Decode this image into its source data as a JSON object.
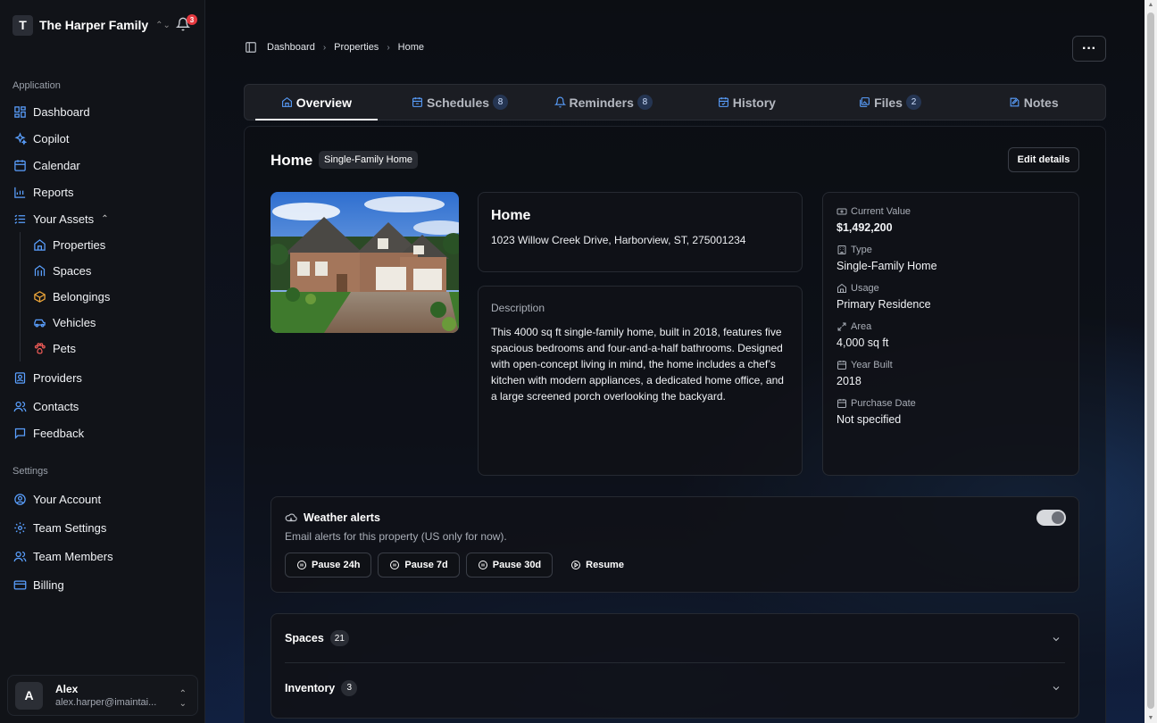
{
  "family": {
    "initial": "T",
    "name": "The Harper Family",
    "notifications": "3"
  },
  "sidebar": {
    "application_label": "Application",
    "items": [
      {
        "label": "Dashboard",
        "icon": "dashboard-icon"
      },
      {
        "label": "Copilot",
        "icon": "sparkle-icon"
      },
      {
        "label": "Calendar",
        "icon": "calendar-icon"
      },
      {
        "label": "Reports",
        "icon": "chart-icon"
      },
      {
        "label": "Your Assets",
        "icon": "list-icon"
      }
    ],
    "assets": [
      {
        "label": "Properties",
        "icon": "house-icon",
        "color": "#5aa0ff"
      },
      {
        "label": "Spaces",
        "icon": "columns-icon",
        "color": "#5aa0ff"
      },
      {
        "label": "Belongings",
        "icon": "box-icon",
        "color": "#f0a83a"
      },
      {
        "label": "Vehicles",
        "icon": "car-icon",
        "color": "#5aa0ff"
      },
      {
        "label": "Pets",
        "icon": "paw-icon",
        "color": "#ef5b57"
      }
    ],
    "more_items": [
      {
        "label": "Providers",
        "icon": "contact-book-icon"
      },
      {
        "label": "Contacts",
        "icon": "users-icon"
      },
      {
        "label": "Feedback",
        "icon": "message-icon"
      }
    ],
    "settings_label": "Settings",
    "settings_items": [
      {
        "label": "Your Account",
        "icon": "user-circle-icon"
      },
      {
        "label": "Team Settings",
        "icon": "gear-icon"
      },
      {
        "label": "Team Members",
        "icon": "users-icon"
      },
      {
        "label": "Billing",
        "icon": "card-icon"
      }
    ]
  },
  "user": {
    "initial": "A",
    "name": "Alex",
    "email": "alex.harper@imaintai..."
  },
  "breadcrumb": {
    "items": [
      "Dashboard",
      "Properties",
      "Home"
    ]
  },
  "tabs": [
    {
      "label": "Overview",
      "icon": "house-icon",
      "count": ""
    },
    {
      "label": "Schedules",
      "icon": "calendar-sync-icon",
      "count": "8"
    },
    {
      "label": "Reminders",
      "icon": "bell-icon",
      "count": "8"
    },
    {
      "label": "History",
      "icon": "calendar-check-icon",
      "count": ""
    },
    {
      "label": "Files",
      "icon": "images-icon",
      "count": "2"
    },
    {
      "label": "Notes",
      "icon": "note-icon",
      "count": ""
    }
  ],
  "property": {
    "title": "Home",
    "type_badge": "Single-Family Home",
    "edit_label": "Edit details",
    "card_title": "Home",
    "address": "1023 Willow Creek Drive, Harborview, ST, 275001234",
    "description_label": "Description",
    "description": "This 4000 sq ft single-family home, built in 2018, features five spacious bedrooms and four-and-a-half bathrooms. Designed with open-concept living in mind, the home includes a chef’s kitchen with modern appliances, a dedicated home office, and a large screened porch overlooking the backyard."
  },
  "facts": [
    {
      "label": "Current Value",
      "value": "$1,492,200",
      "icon": "banknote-icon"
    },
    {
      "label": "Type",
      "value": "Single-Family Home",
      "icon": "building-icon"
    },
    {
      "label": "Usage",
      "value": "Primary Residence",
      "icon": "house-icon"
    },
    {
      "label": "Area",
      "value": "4,000 sq ft",
      "icon": "expand-icon"
    },
    {
      "label": "Year Built",
      "value": "2018",
      "icon": "calendar-icon"
    },
    {
      "label": "Purchase Date",
      "value": "Not specified",
      "icon": "calendar-icon"
    }
  ],
  "weather": {
    "title": "Weather alerts",
    "subtitle": "Email alerts for this property (US only for now).",
    "enabled": true,
    "buttons": [
      "Pause 24h",
      "Pause 7d",
      "Pause 30d"
    ],
    "resume_label": "Resume"
  },
  "accordions": [
    {
      "label": "Spaces",
      "count": "21"
    },
    {
      "label": "Inventory",
      "count": "3"
    }
  ]
}
